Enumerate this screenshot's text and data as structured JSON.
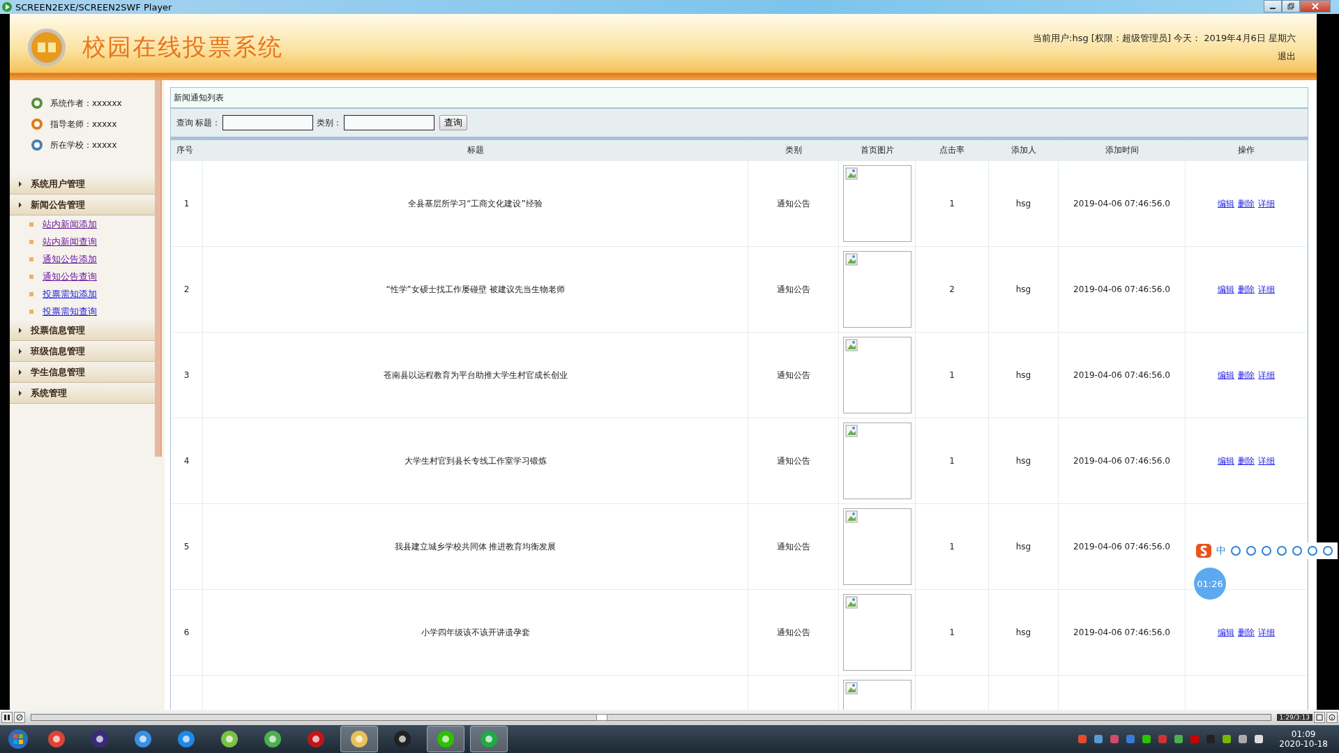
{
  "window": {
    "title": "SCREEN2EXE/SCREEN2SWF Player"
  },
  "header": {
    "title": "校园在线投票系统",
    "user_info": "当前用户:hsg [权限：超级管理员] 今天： 2019年4月6日 星期六",
    "logout": "退出"
  },
  "sidebar": {
    "info": [
      {
        "kind": "author",
        "text": "系统作者：xxxxxx"
      },
      {
        "kind": "teacher",
        "text": "指导老师：xxxxx"
      },
      {
        "kind": "school",
        "text": "所在学校：xxxxx"
      }
    ],
    "menus": [
      {
        "label": "系统用户管理"
      },
      {
        "label": "新闻公告管理",
        "children": [
          {
            "label": "站内新闻添加",
            "visited": true
          },
          {
            "label": "站内新闻查询",
            "visited": true
          },
          {
            "label": "通知公告添加",
            "visited": true
          },
          {
            "label": "通知公告查询",
            "visited": true
          },
          {
            "label": "投票需知添加",
            "visited": false
          },
          {
            "label": "投票需知查询",
            "visited": false
          }
        ]
      },
      {
        "label": "投票信息管理"
      },
      {
        "label": "班级信息管理"
      },
      {
        "label": "学生信息管理"
      },
      {
        "label": "系统管理"
      }
    ]
  },
  "panel": {
    "title": "新闻通知列表",
    "search": {
      "label": "查询",
      "fields": [
        {
          "label": "标题："
        },
        {
          "label": "类别："
        }
      ],
      "button": "查询"
    },
    "table": {
      "columns": [
        "序号",
        "标题",
        "类别",
        "首页图片",
        "点击率",
        "添加人",
        "添加时间",
        "操作"
      ],
      "rows": [
        {
          "kind": "full",
          "no": "1",
          "title": "全县基层所学习“工商文化建设”经验",
          "category": "通知公告",
          "clicks": "1",
          "author": "hsg",
          "time": "2019-04-06 07:46:56.0",
          "ops": [
            "编辑",
            "删除",
            "详细"
          ]
        },
        {
          "kind": "full",
          "no": "2",
          "title": "“性学”女硕士找工作屡碰壁 被建议先当生物老师",
          "category": "通知公告",
          "clicks": "2",
          "author": "hsg",
          "time": "2019-04-06 07:46:56.0",
          "ops": [
            "编辑",
            "删除",
            "详细"
          ]
        },
        {
          "kind": "full",
          "no": "3",
          "title": "苍南县以远程教育为平台助推大学生村官成长创业",
          "category": "通知公告",
          "clicks": "1",
          "author": "hsg",
          "time": "2019-04-06 07:46:56.0",
          "ops": [
            "编辑",
            "删除",
            "详细"
          ]
        },
        {
          "kind": "full",
          "no": "4",
          "title": "大学生村官到县长专线工作室学习锻炼",
          "category": "通知公告",
          "clicks": "1",
          "author": "hsg",
          "time": "2019-04-06 07:46:56.0",
          "ops": [
            "编辑",
            "删除",
            "详细"
          ]
        },
        {
          "kind": "full",
          "no": "5",
          "title": "我县建立城乡学校共同体 推进教育均衡发展",
          "category": "通知公告",
          "clicks": "1",
          "author": "hsg",
          "time": "2019-04-06 07:46:56.0"
        },
        {
          "kind": "full",
          "no": "6",
          "title": "小学四年级该不该开讲遗孕套",
          "category": "通知公告",
          "clicks": "1",
          "author": "hsg",
          "time": "2019-04-06 07:46:56.0",
          "ops": [
            "编辑",
            "删除",
            "详细"
          ]
        },
        {
          "kind": "cut"
        }
      ]
    }
  },
  "ime_toolbar": {
    "mode": "中"
  },
  "timer": {
    "text": "01:26"
  },
  "player": {
    "level": 0.46,
    "time": "1:29/3:13"
  },
  "taskbar": {
    "apps": [
      {
        "kind": "chrome",
        "open": false
      },
      {
        "kind": "eclipse",
        "open": false
      },
      {
        "kind": "cloud",
        "open": false
      },
      {
        "kind": "browser",
        "open": false
      },
      {
        "kind": "leaf",
        "open": false
      },
      {
        "kind": "chart",
        "open": false
      },
      {
        "kind": "flash",
        "open": false
      },
      {
        "kind": "folder",
        "open": true
      },
      {
        "kind": "penguin",
        "open": false
      },
      {
        "kind": "chat",
        "open": true
      },
      {
        "kind": "player",
        "open": true
      }
    ],
    "clock": {
      "time": "01:09",
      "date": "2020-10-18"
    }
  }
}
